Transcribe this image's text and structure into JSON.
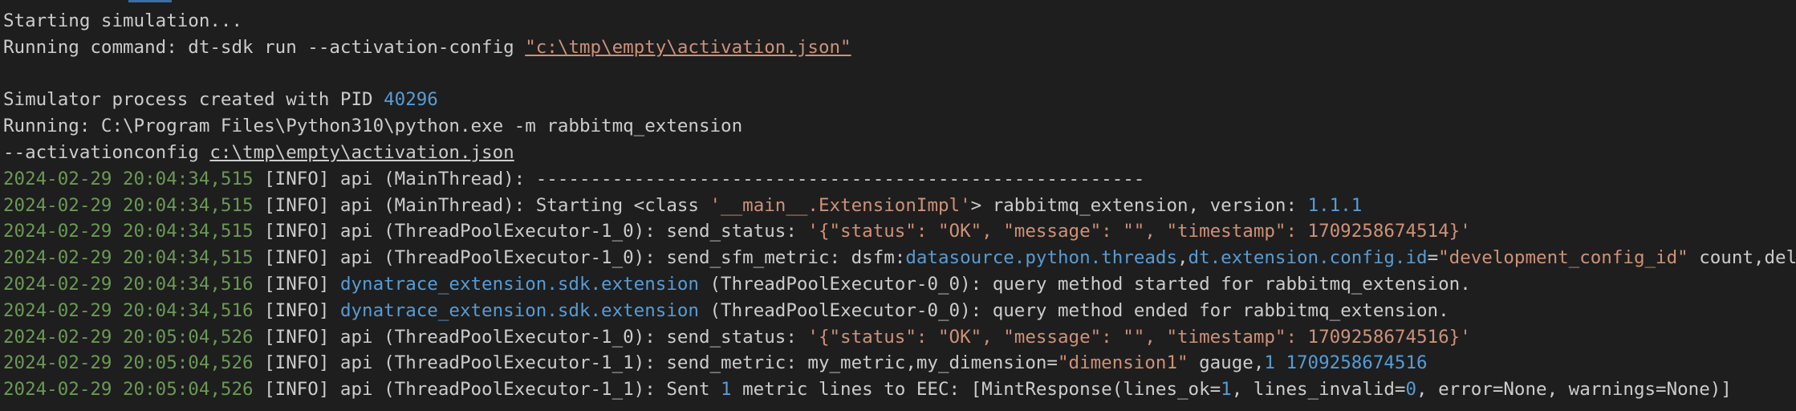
{
  "lines": {
    "l1": {
      "text": "Starting simulation..."
    },
    "l2": {
      "prefix": "Running command: dt-sdk run --activation-config ",
      "quoted": "\"c:\\tmp\\empty\\activation.json\""
    },
    "l3": {
      "text": ""
    },
    "l4": {
      "prefix": "Simulator process created with PID ",
      "pid": "40296"
    },
    "l5": {
      "text": "Running: C:\\Program Files\\Python310\\python.exe -m rabbitmq_extension"
    },
    "l6": {
      "prefix": "--activationconfig ",
      "path": "c:\\tmp\\empty\\activation.json"
    },
    "l7": {
      "ts": "2024-02-29 20:04:34,515",
      "rest": " [INFO] api (MainThread): --------------------------------------------------------"
    },
    "l8": {
      "ts": "2024-02-29 20:04:34,515",
      "a": " [INFO] api (MainThread): Starting <class ",
      "s": "'__main__.ExtensionImpl'",
      "b": "> rabbitmq_extension, version: ",
      "ver": "1.1.1"
    },
    "l9": {
      "ts": "2024-02-29 20:04:34,515",
      "a": " [INFO] api (ThreadPoolExecutor-1_0): send_status: ",
      "s": "'{\"status\": \"OK\", \"message\": \"\", \"timestamp\": 1709258674514}'"
    },
    "l10": {
      "ts": "2024-02-29 20:04:34,515",
      "a": " [INFO] api (ThreadPoolExecutor-1_0): send_sfm_metric: dsfm:",
      "m1": "datasource.python.threads",
      "c1": ",",
      "m2": "dt.extension.config.id",
      "c2": "=",
      "s": "\"development_config_id\"",
      "b": " count,delta="
    },
    "l11": {
      "ts": "2024-02-29 20:04:34,516",
      "a": " [INFO] ",
      "mod": "dynatrace_extension.sdk.extension",
      "b": " (ThreadPoolExecutor-0_0): query method started for rabbitmq_extension."
    },
    "l12": {
      "ts": "2024-02-29 20:04:34,516",
      "a": " [INFO] ",
      "mod": "dynatrace_extension.sdk.extension",
      "b": " (ThreadPoolExecutor-0_0): query method ended for rabbitmq_extension."
    },
    "l13": {
      "ts": "2024-02-29 20:05:04,526",
      "a": " [INFO] api (ThreadPoolExecutor-1_0): send_status: ",
      "s": "'{\"status\": \"OK\", \"message\": \"\", \"timestamp\": 1709258674516}'"
    },
    "l14": {
      "ts": "2024-02-29 20:05:04,526",
      "a": " [INFO] api (ThreadPoolExecutor-1_1): send_metric: my_metric,my_dimension=",
      "s": "\"dimension1\"",
      "b": " gauge,",
      "n1": "1",
      "c": " ",
      "n2": "1709258674516"
    },
    "l15": {
      "ts": "2024-02-29 20:05:04,526",
      "a": " [INFO] api (ThreadPoolExecutor-1_1): Sent ",
      "n1": "1",
      "b": " metric lines to EEC: [MintResponse(lines_ok=",
      "n2": "1",
      "c": ", lines_invalid=",
      "n3": "0",
      "d": ", error=None, warnings=None)]"
    }
  }
}
